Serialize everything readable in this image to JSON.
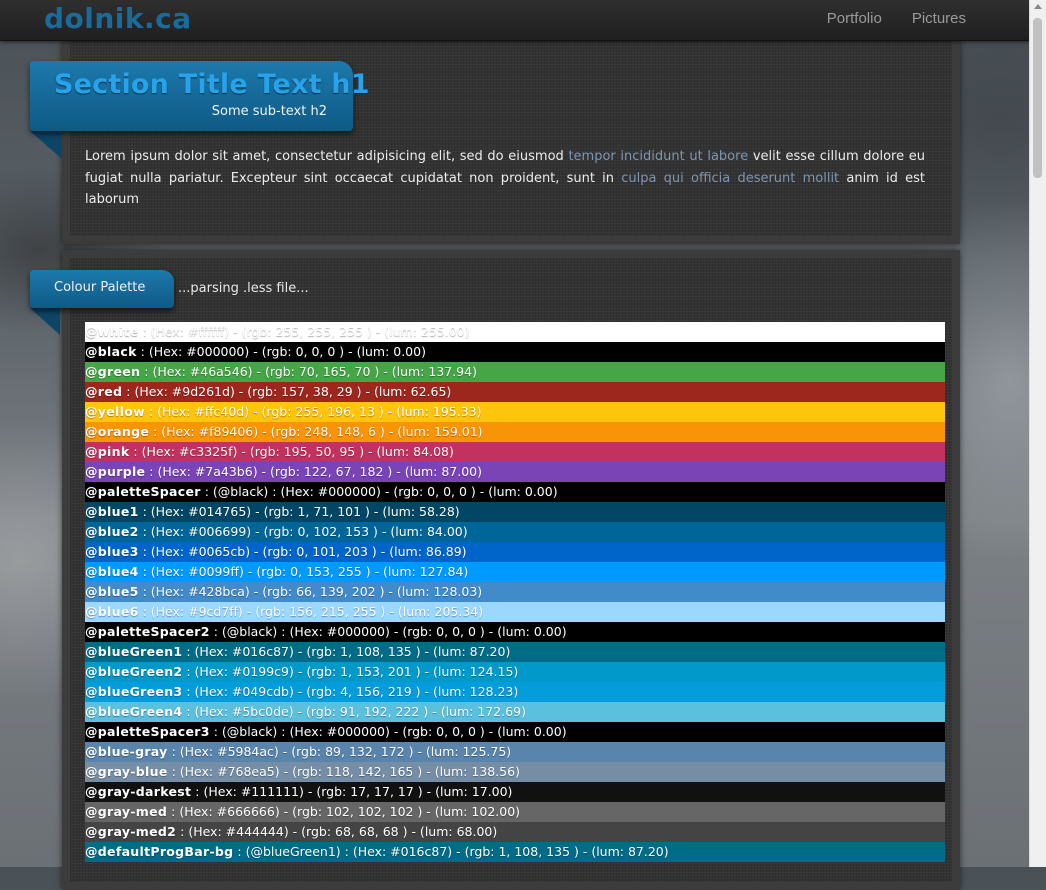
{
  "brand": "dolnik.ca",
  "nav": [
    "Portfolio",
    "Pictures"
  ],
  "section": {
    "title": "Section Title Text h1",
    "subtitle": "Some sub-text h2",
    "intro": {
      "p1": "Lorem ipsum dolor sit amet, consectetur adipisicing elit, sed do eiusmod ",
      "link1": "tempor incididunt ut labore",
      "p2": " velit esse cillum dolore eu fugiat nulla pariatur. Excepteur sint occaecat cupidatat non proident, sunt in ",
      "link2": "culpa qui officia deserunt mollit",
      "p3": " anim id est laborum"
    }
  },
  "palette": {
    "title": "Colour Palette",
    "status": "...parsing .less file...",
    "entries": [
      {
        "name": "@white",
        "details": " : (Hex: #ffffff) - (rgb: 255, 255, 255 ) - (lum: 255.00)",
        "bg": "#ffffff"
      },
      {
        "name": "@black",
        "details": " : (Hex: #000000) - (rgb: 0, 0, 0 ) - (lum: 0.00)",
        "bg": "#000000"
      },
      {
        "name": "@green",
        "details": " : (Hex: #46a546) - (rgb: 70, 165, 70 ) - (lum: 137.94)",
        "bg": "#46a546"
      },
      {
        "name": "@red",
        "details": " : (Hex: #9d261d) - (rgb: 157, 38, 29 ) - (lum: 62.65)",
        "bg": "#9d261d"
      },
      {
        "name": "@yellow",
        "details": " : (Hex: #ffc40d) - (rgb: 255, 196, 13 ) - (lum: 195.33)",
        "bg": "#ffc40d"
      },
      {
        "name": "@orange",
        "details": " : (Hex: #f89406) - (rgb: 248, 148, 6 ) - (lum: 159.01)",
        "bg": "#f89406"
      },
      {
        "name": "@pink",
        "details": " : (Hex: #c3325f) - (rgb: 195, 50, 95 ) - (lum: 84.08)",
        "bg": "#c3325f"
      },
      {
        "name": "@purple",
        "details": " : (Hex: #7a43b6) - (rgb: 122, 67, 182 ) - (lum: 87.00)",
        "bg": "#7a43b6"
      },
      {
        "name": "@paletteSpacer",
        "details": " : (@black) : (Hex: #000000) - (rgb: 0, 0, 0 ) - (lum: 0.00)",
        "bg": "#000000"
      },
      {
        "name": "@blue1",
        "details": " : (Hex: #014765) - (rgb: 1, 71, 101 ) - (lum: 58.28)",
        "bg": "#014765"
      },
      {
        "name": "@blue2",
        "details": " : (Hex: #006699) - (rgb: 0, 102, 153 ) - (lum: 84.00)",
        "bg": "#006699"
      },
      {
        "name": "@blue3",
        "details": " : (Hex: #0065cb) - (rgb: 0, 101, 203 ) - (lum: 86.89)",
        "bg": "#0065cb"
      },
      {
        "name": "@blue4",
        "details": " : (Hex: #0099ff) - (rgb: 0, 153, 255 ) - (lum: 127.84)",
        "bg": "#0099ff"
      },
      {
        "name": "@blue5",
        "details": " : (Hex: #428bca) - (rgb: 66, 139, 202 ) - (lum: 128.03)",
        "bg": "#428bca"
      },
      {
        "name": "@blue6",
        "details": " : (Hex: #9cd7ff) - (rgb: 156, 215, 255 ) - (lum: 205.34)",
        "bg": "#9cd7ff"
      },
      {
        "name": "@paletteSpacer2",
        "details": " : (@black) : (Hex: #000000) - (rgb: 0, 0, 0 ) - (lum: 0.00)",
        "bg": "#000000"
      },
      {
        "name": "@blueGreen1",
        "details": " : (Hex: #016c87) - (rgb: 1, 108, 135 ) - (lum: 87.20)",
        "bg": "#016c87"
      },
      {
        "name": "@blueGreen2",
        "details": " : (Hex: #0199c9) - (rgb: 1, 153, 201 ) - (lum: 124.15)",
        "bg": "#0199c9"
      },
      {
        "name": "@blueGreen3",
        "details": " : (Hex: #049cdb) - (rgb: 4, 156, 219 ) - (lum: 128.23)",
        "bg": "#049cdb"
      },
      {
        "name": "@blueGreen4",
        "details": " : (Hex: #5bc0de) - (rgb: 91, 192, 222 ) - (lum: 172.69)",
        "bg": "#5bc0de"
      },
      {
        "name": "@paletteSpacer3",
        "details": " : (@black) : (Hex: #000000) - (rgb: 0, 0, 0 ) - (lum: 0.00)",
        "bg": "#000000"
      },
      {
        "name": "@blue-gray",
        "details": " : (Hex: #5984ac) - (rgb: 89, 132, 172 ) - (lum: 125.75)",
        "bg": "#5984ac"
      },
      {
        "name": "@gray-blue",
        "details": " : (Hex: #768ea5) - (rgb: 118, 142, 165 ) - (lum: 138.56)",
        "bg": "#768ea5"
      },
      {
        "name": "@gray-darkest",
        "details": " : (Hex: #111111) - (rgb: 17, 17, 17 ) - (lum: 17.00)",
        "bg": "#111111"
      },
      {
        "name": "@gray-med",
        "details": " : (Hex: #666666) - (rgb: 102, 102, 102 ) - (lum: 102.00)",
        "bg": "#666666"
      },
      {
        "name": "@gray-med2",
        "details": " : (Hex: #444444) - (rgb: 68, 68, 68 ) - (lum: 68.00)",
        "bg": "#444444"
      },
      {
        "name": "@defaultProgBar-bg",
        "details": " : (@blueGreen1) : (Hex: #016c87) - (rgb: 1, 108, 135 ) - (lum: 87.20)",
        "bg": "#016c87"
      }
    ]
  }
}
